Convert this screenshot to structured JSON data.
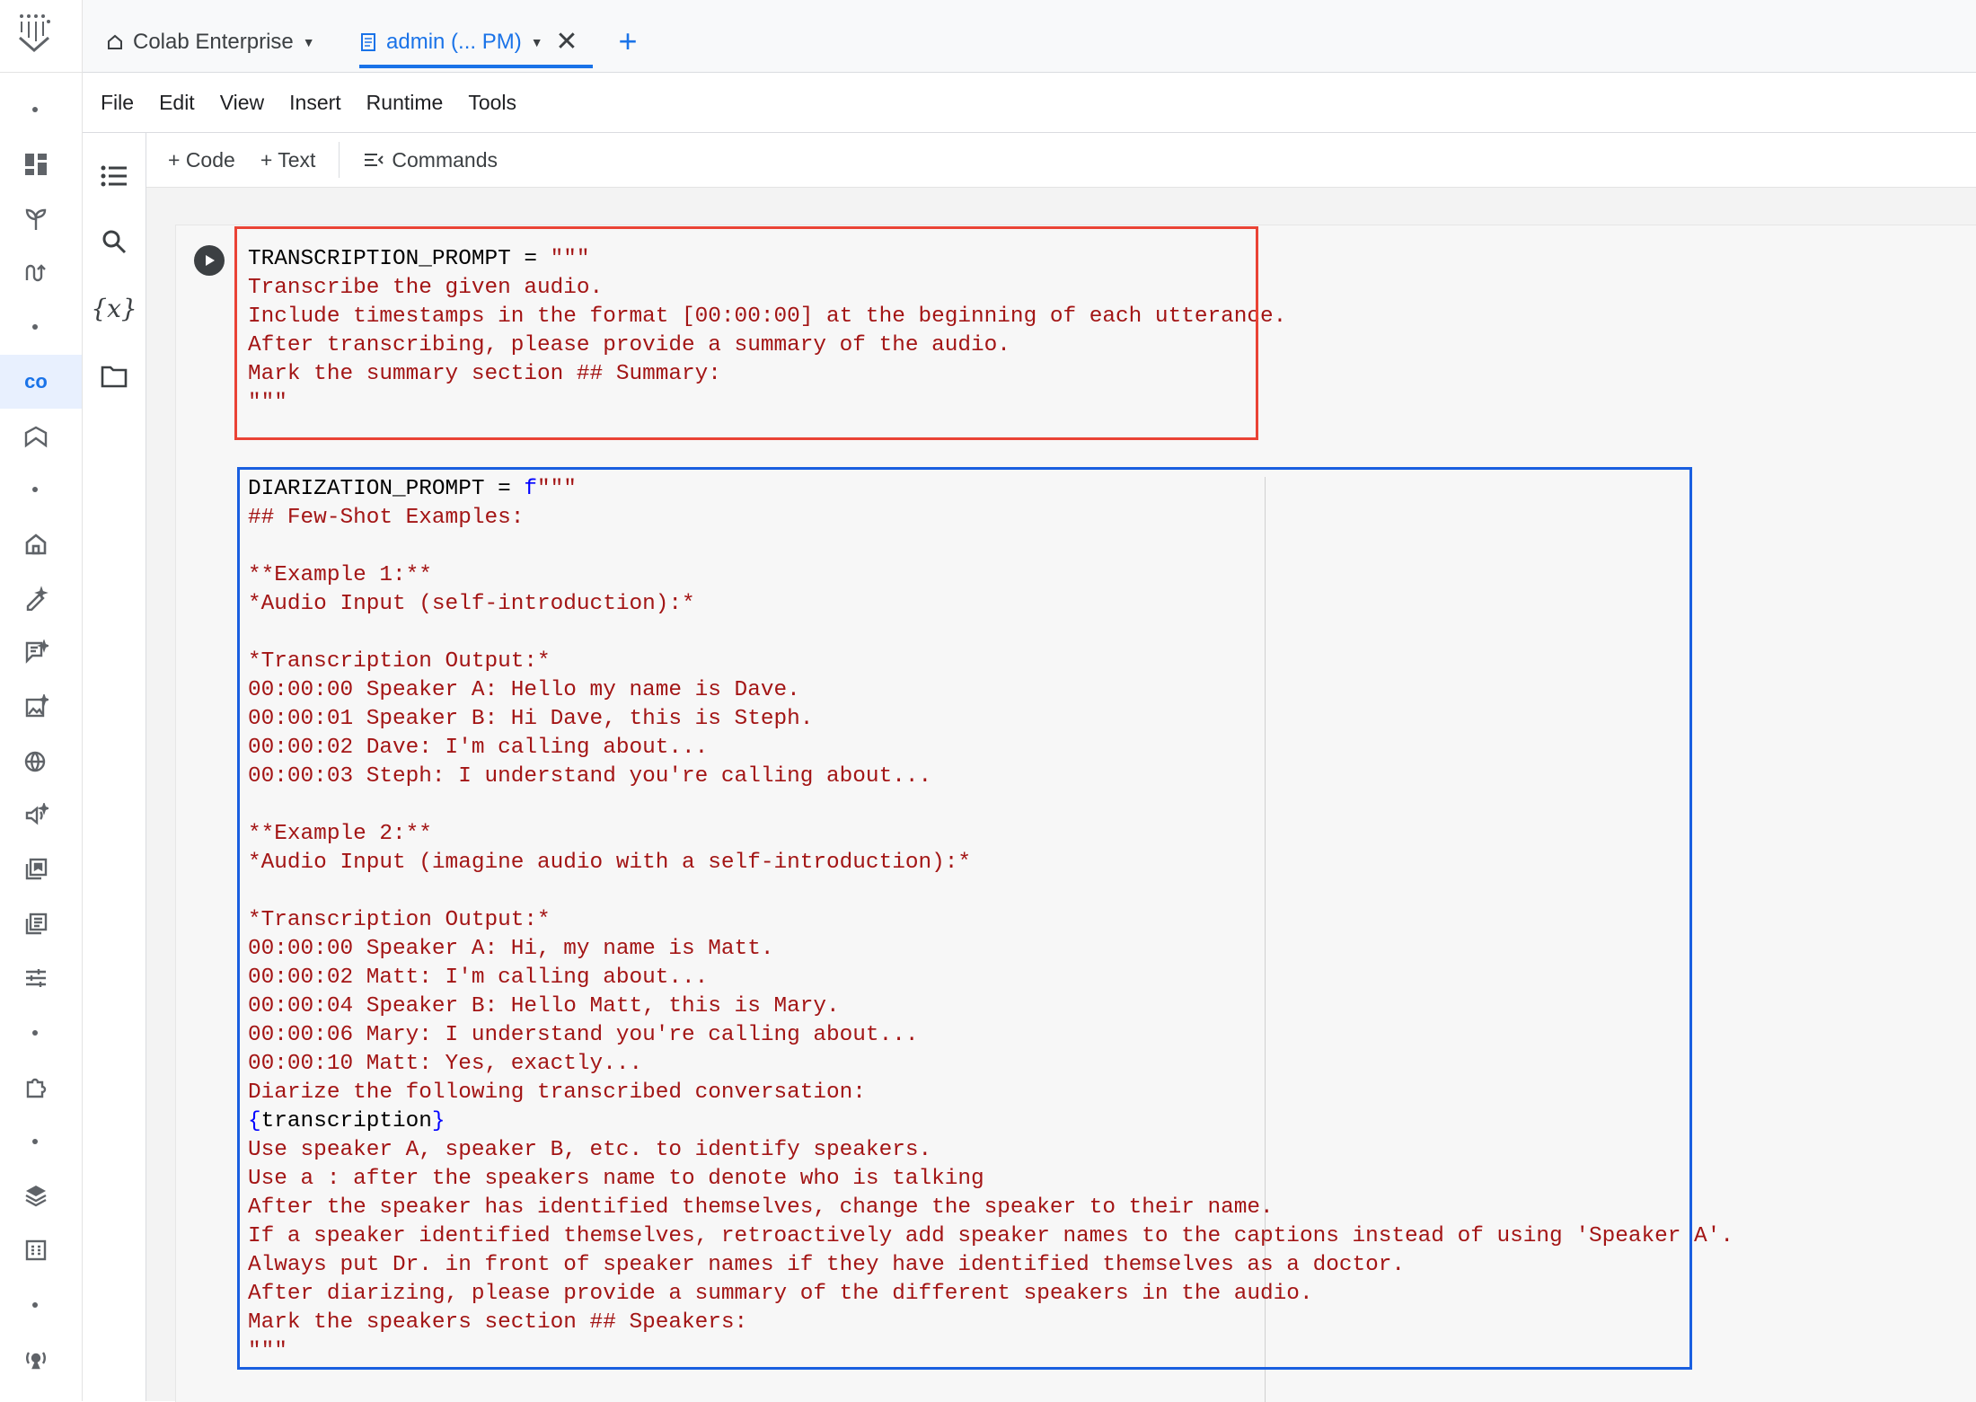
{
  "tabs": {
    "home_label": "Colab Enterprise",
    "doc_label": "admin (... PM)",
    "add_label": "+",
    "close_label": "✕"
  },
  "menu": [
    "File",
    "Edit",
    "View",
    "Insert",
    "Runtime",
    "Tools"
  ],
  "toolbar": {
    "code_label": "+ Code",
    "text_label": "+ Text",
    "commands_label": "Commands"
  },
  "cell": {
    "transcription_head": "TRANSCRIPTION_PROMPT = ",
    "transcription_open": "\"\"\"",
    "transcription_body": "Transcribe the given audio.\nInclude timestamps in the format [00:00:00] at the beginning of each utterance.\nAfter transcribing, please provide a summary of the audio.\nMark the summary section ## Summary:\n\"\"\"",
    "diarization_head": "DIARIZATION_PROMPT = ",
    "diarization_prefix": "f",
    "diarization_open": "\"\"\"",
    "diarization_body_1": "## Few-Shot Examples:\n\n**Example 1:**\n*Audio Input (self-introduction):*\n\n*Transcription Output:*\n00:00:00 Speaker A: Hello my name is Dave.\n00:00:01 Speaker B: Hi Dave, this is Steph.\n00:00:02 Dave: I'm calling about...\n00:00:03 Steph: I understand you're calling about...\n\n**Example 2:**\n*Audio Input (imagine audio with a self-introduction):*\n\n*Transcription Output:*\n00:00:00 Speaker A: Hi, my name is Matt.\n00:00:02 Matt: I'm calling about...\n00:00:04 Speaker B: Hello Matt, this is Mary.\n00:00:06 Mary: I understand you're calling about...\n00:00:10 Matt: Yes, exactly...\nDiarize the following transcribed conversation:",
    "interp_open": "{",
    "interp_var": "transcription",
    "interp_close": "}",
    "diarization_body_2": "Use speaker A, speaker B, etc. to identify speakers.\nUse a : after the speakers name to denote who is talking\nAfter the speaker has identified themselves, change the speaker to their name.\nIf a speaker identified themselves, retroactively add speaker names to the captions instead of using 'Speaker A'.\nAlways put Dr. in front of speaker names if they have identified themselves as a doctor.\nAfter diarizing, please provide a summary of the different speakers in the audio.\nMark the speakers section ## Speakers:\n\"\"\""
  },
  "colors": {
    "accent": "#1a73e8",
    "code_string": "#a31515",
    "highlight_red": "#ea4335",
    "highlight_blue": "#1a5fe0"
  }
}
